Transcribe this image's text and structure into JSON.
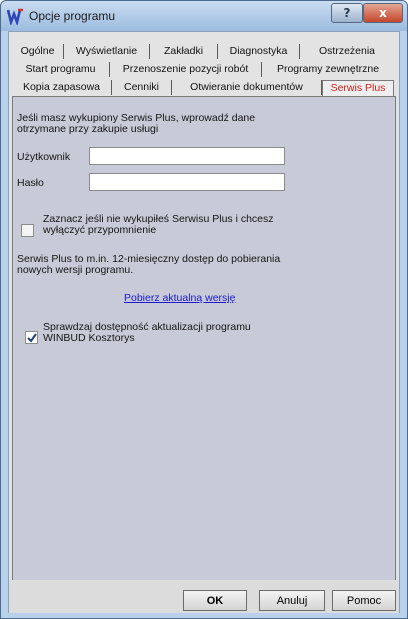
{
  "window": {
    "title": "Opcje programu",
    "help_label": "?",
    "close_label": "x"
  },
  "tabs": {
    "row1": [
      "Ogólne",
      "Wyświetlanie",
      "Zakładki",
      "Diagnostyka",
      "Ostrzeżenia"
    ],
    "row2": [
      "Start programu",
      "Przenoszenie pozycji robót",
      "Programy zewnętrzne"
    ],
    "row3": [
      "Kopia zapasowa",
      "Cenniki",
      "Otwieranie dokumentów",
      "Serwis Plus"
    ],
    "active": "Serwis Plus"
  },
  "serwis": {
    "intro_line1": "Jeśli masz wykupiony Serwis Plus, wprowadź dane",
    "intro_line2": "otrzymane przy zakupie usługi",
    "user_label": "Użytkownik",
    "user_value": "",
    "password_label": "Hasło",
    "password_value": "",
    "reminder_line1": "Zaznacz jeśli nie wykupiłeś Serwisu Plus i chcesz",
    "reminder_line2": "wyłączyć przypomnienie",
    "reminder_checked": false,
    "info_line1": "Serwis Plus to m.in. 12-miesięczny dostęp do pobierania",
    "info_line2": "nowych wersji programu.",
    "download_link": "Pobierz aktualną wersję",
    "update_line1": "Sprawdzaj dostępność aktualizacji programu",
    "update_line2": "WINBUD Kosztorys",
    "update_checked": true
  },
  "buttons": {
    "ok": "OK",
    "cancel": "Anuluj",
    "help": "Pomoc"
  },
  "colors": {
    "active_tab_text": "#d0241b",
    "link": "#1a1acc"
  }
}
